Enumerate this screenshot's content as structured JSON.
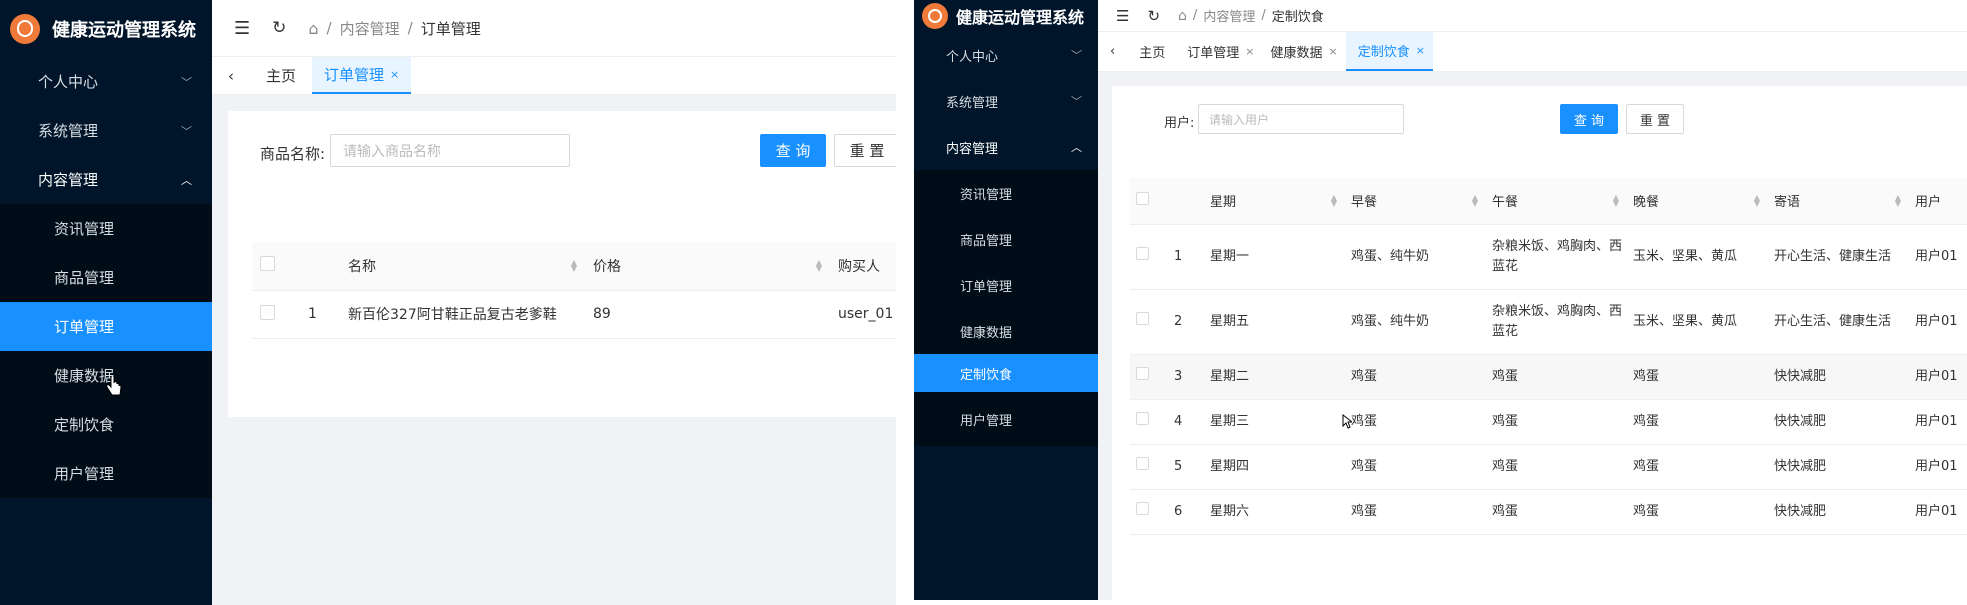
{
  "left": {
    "app_title": "健康运动管理系统",
    "menu": {
      "personal": "个人中心",
      "system": "系统管理",
      "content": "内容管理",
      "sub": [
        "资讯管理",
        "商品管理",
        "订单管理",
        "健康数据",
        "定制饮食",
        "用户管理"
      ]
    },
    "topbar": {
      "collapse_icon": "menu-fold-icon",
      "refresh_icon": "refresh-icon",
      "home_icon": "home-icon",
      "crumb1": "内容管理",
      "crumb2": "订单管理",
      "sep": "/"
    },
    "tabs": {
      "home": "主页",
      "active": "订单管理",
      "close": "×"
    },
    "search": {
      "label": "商品名称:",
      "placeholder": "请输入商品名称",
      "query": "查 询",
      "reset": "重 置"
    },
    "table": {
      "headers": [
        "名称",
        "价格",
        "购买人"
      ],
      "rows": [
        {
          "index": "1",
          "name": "新百伦327阿甘鞋正品复古老爹鞋",
          "price": "89",
          "buyer": "user_01"
        }
      ]
    }
  },
  "right": {
    "app_title": "健康运动管理系统",
    "menu": {
      "personal": "个人中心",
      "system": "系统管理",
      "content": "内容管理",
      "sub": [
        "资讯管理",
        "商品管理",
        "订单管理",
        "健康数据",
        "定制饮食",
        "用户管理"
      ]
    },
    "topbar": {
      "crumb1": "内容管理",
      "crumb2": "定制饮食",
      "sep": "/"
    },
    "tabs": [
      "主页",
      "订单管理",
      "健康数据",
      "定制饮食"
    ],
    "search": {
      "label": "用户:",
      "placeholder": "请输入用户",
      "query": "查 询",
      "reset": "重 置"
    },
    "table": {
      "headers": [
        "星期",
        "早餐",
        "午餐",
        "晚餐",
        "寄语",
        "用户"
      ],
      "rows": [
        {
          "index": "1",
          "day": "星期一",
          "breakfast": "鸡蛋、纯牛奶",
          "lunch": "杂粮米饭、鸡胸肉、西蓝花",
          "dinner": "玉米、坚果、黄瓜",
          "msg": "开心生活、健康生活",
          "user": "用户01"
        },
        {
          "index": "2",
          "day": "星期五",
          "breakfast": "鸡蛋、纯牛奶",
          "lunch": "杂粮米饭、鸡胸肉、西蓝花",
          "dinner": "玉米、坚果、黄瓜",
          "msg": "开心生活、健康生活",
          "user": "用户01"
        },
        {
          "index": "3",
          "day": "星期二",
          "breakfast": "鸡蛋",
          "lunch": "鸡蛋",
          "dinner": "鸡蛋",
          "msg": "快快减肥",
          "user": "用户01"
        },
        {
          "index": "4",
          "day": "星期三",
          "breakfast": "鸡蛋",
          "lunch": "鸡蛋",
          "dinner": "鸡蛋",
          "msg": "快快减肥",
          "user": "用户01"
        },
        {
          "index": "5",
          "day": "星期四",
          "breakfast": "鸡蛋",
          "lunch": "鸡蛋",
          "dinner": "鸡蛋",
          "msg": "快快减肥",
          "user": "用户01"
        },
        {
          "index": "6",
          "day": "星期六",
          "breakfast": "鸡蛋",
          "lunch": "鸡蛋",
          "dinner": "鸡蛋",
          "msg": "快快减肥",
          "user": "用户01"
        }
      ]
    }
  },
  "colors": {
    "sidebar": "#001529",
    "submenu": "#000c17",
    "primary": "#1890ff",
    "logo": "#f07a3a"
  }
}
